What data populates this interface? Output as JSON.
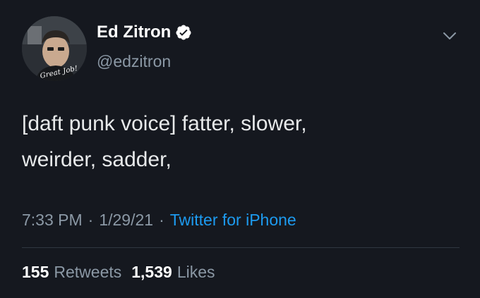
{
  "author": {
    "display_name": "Ed Zitron",
    "handle": "@edzitron",
    "verified": true,
    "avatar_caption": "Great Job!"
  },
  "tweet": {
    "text": "[daft punk voice] fatter, slower,\nweirder, sadder,"
  },
  "meta": {
    "time": "7:33 PM",
    "separator_1": "·",
    "date": "1/29/21",
    "separator_2": "·",
    "source": "Twitter for iPhone"
  },
  "stats": {
    "retweets_count": "155",
    "retweets_label": "Retweets",
    "likes_count": "1,539",
    "likes_label": "Likes"
  },
  "icons": {
    "verified": "verified-badge-icon",
    "menu": "chevron-down-icon"
  },
  "colors": {
    "background": "#15181f",
    "link": "#1d9bf0",
    "secondary_text": "#8b98a5",
    "primary_text": "#e7e9ea"
  }
}
